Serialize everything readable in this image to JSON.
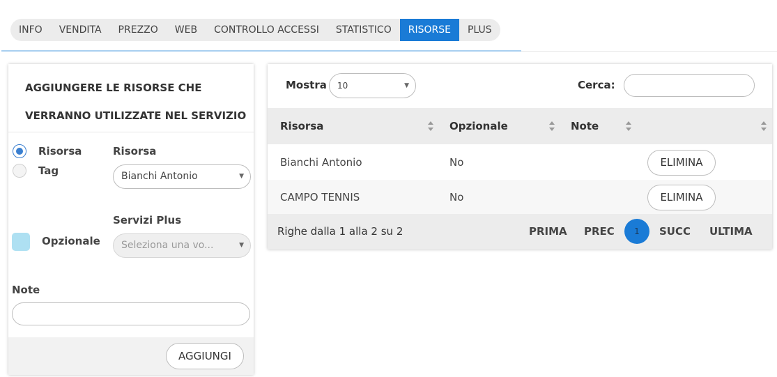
{
  "tabs": [
    {
      "label": "INFO",
      "active": false
    },
    {
      "label": "VENDITA",
      "active": false
    },
    {
      "label": "PREZZO",
      "active": false
    },
    {
      "label": "WEB",
      "active": false
    },
    {
      "label": "CONTROLLO ACCESSI",
      "active": false
    },
    {
      "label": "STATISTICO",
      "active": false
    },
    {
      "label": "RISORSE",
      "active": true
    },
    {
      "label": "PLUS",
      "active": false
    }
  ],
  "form": {
    "header_line1": "AGGIUNGERE LE RISORSE CHE",
    "header_line2": "VERRANNO UTILIZZATE NEL SERVIZIO",
    "type_options": [
      {
        "label": "Risorsa",
        "selected": true
      },
      {
        "label": "Tag",
        "selected": false
      }
    ],
    "resource_label": "Risorsa",
    "resource_value": "Bianchi Antonio",
    "services_label": "Servizi Plus",
    "services_placeholder": "Seleziona una vo...",
    "optional_label": "Opzionale",
    "optional_checked": false,
    "note_label": "Note",
    "note_value": "",
    "add_button": "AGGIUNGI"
  },
  "table": {
    "show_label": "Mostra",
    "page_size": "10",
    "search_label": "Cerca:",
    "search_value": "",
    "columns": [
      "Risorsa",
      "Opzionale",
      "Note",
      ""
    ],
    "rows": [
      {
        "risorsa": "Bianchi Antonio",
        "opzionale": "No",
        "note": "",
        "action": "ELIMINA"
      },
      {
        "risorsa": "CAMPO TENNIS",
        "opzionale": "No",
        "note": "",
        "action": "ELIMINA"
      }
    ],
    "info": "Righe dalla 1 alla 2 su 2",
    "pagination": {
      "first": "PRIMA",
      "prev": "PREC",
      "current": "1",
      "next": "SUCC",
      "last": "ULTIMA"
    }
  },
  "colors": {
    "accent": "#1a7bd6",
    "checkbox": "#aee0f2",
    "radio": "#3a7fd0"
  }
}
